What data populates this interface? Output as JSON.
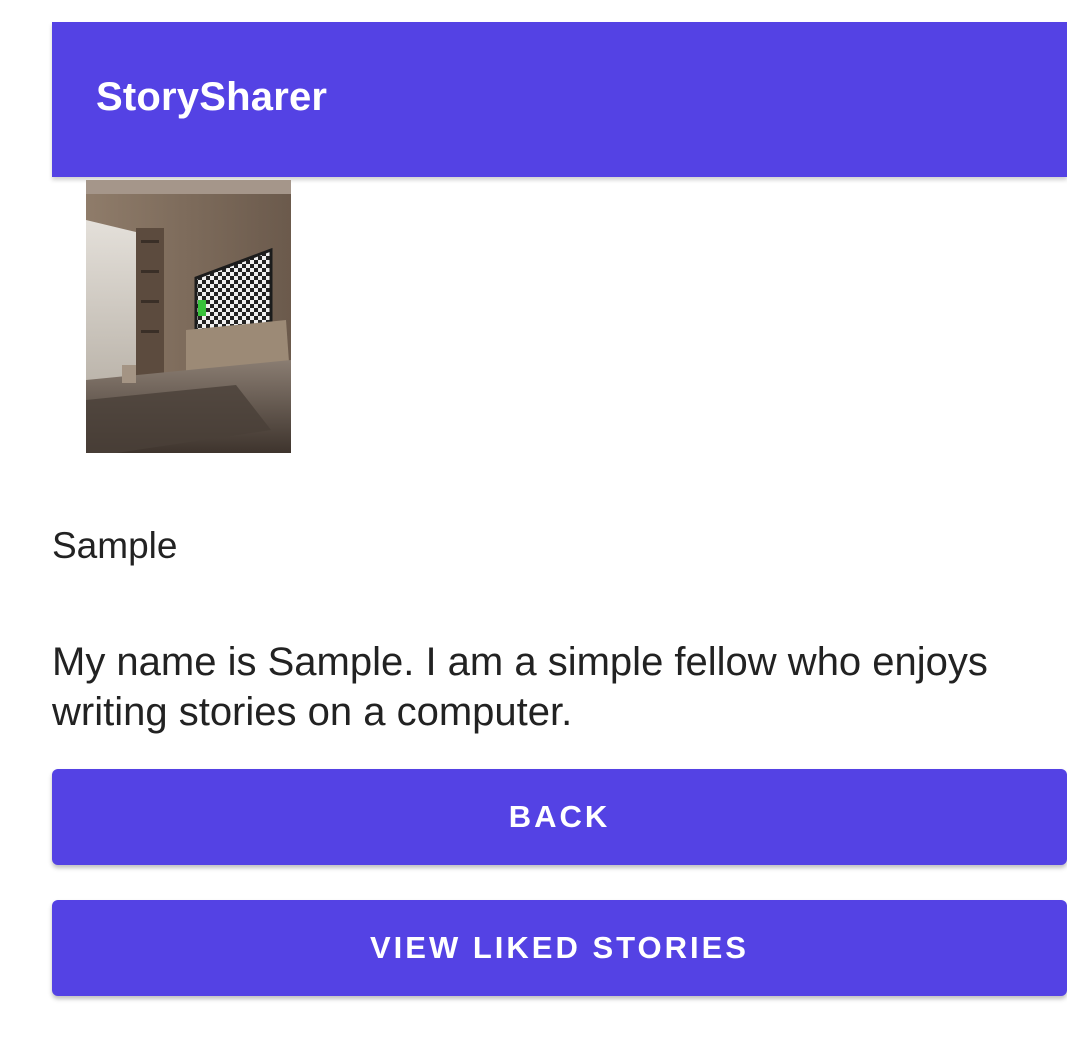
{
  "app": {
    "title": "StorySharer",
    "accent_color": "#5442E4"
  },
  "profile": {
    "photo_description": "living-room-photo",
    "name": "Sample",
    "bio": "My name is Sample. I am a simple fellow who enjoys writing stories on a computer."
  },
  "actions": {
    "back_label": "BACK",
    "liked_label": "VIEW LIKED STORIES"
  }
}
